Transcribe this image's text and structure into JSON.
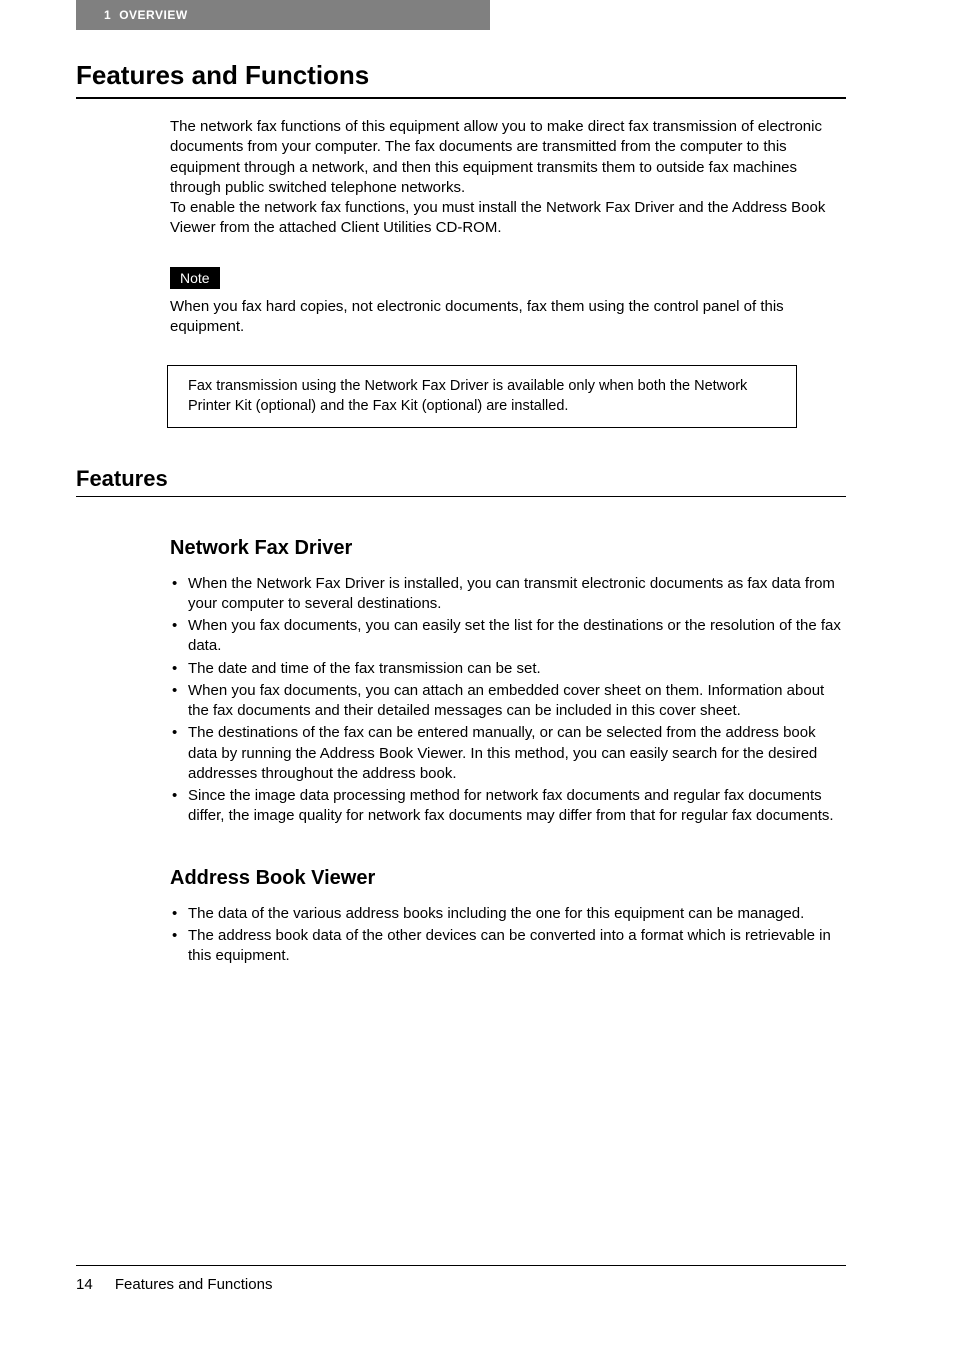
{
  "header": {
    "chapter_number": "1",
    "chapter_title": "OVERVIEW"
  },
  "main_heading": "Features and Functions",
  "intro_paragraph_1": "The network fax functions of this equipment allow you to make direct fax transmission of electronic documents from your computer. The fax documents are transmitted from the computer to this equipment through a network, and then this equipment transmits them to outside fax machines through public switched telephone networks.",
  "intro_paragraph_2": "To enable the network fax functions, you must install the Network Fax Driver and the Address Book Viewer from the attached Client Utilities CD-ROM.",
  "note": {
    "label": "Note",
    "text": "When you fax hard copies, not electronic documents, fax them using the control panel of this equipment."
  },
  "boxed_text": "Fax transmission using the Network Fax Driver is available only when both the Network Printer Kit (optional) and the Fax Kit (optional) are installed.",
  "features_heading": "Features",
  "subsections": [
    {
      "heading": "Network Fax Driver",
      "bullets": [
        "When the Network Fax Driver is installed, you can transmit electronic documents as fax data from your computer to several destinations.",
        "When you fax documents, you can easily set the list for the destinations or the resolution of the fax data.",
        "The date and time of the fax transmission can be set.",
        "When you fax documents, you can attach an embedded cover sheet on them. Information about the fax documents and their detailed messages can be included in this cover sheet.",
        "The destinations of the fax can be entered manually, or can be selected from the address book data by running the Address Book Viewer. In this method, you can easily search for the desired addresses throughout the address book.",
        "Since the image data processing method for network fax documents and regular fax documents differ, the image quality for network fax documents may differ from that for regular fax documents."
      ]
    },
    {
      "heading": "Address Book Viewer",
      "bullets": [
        "The data of the various address books including the one for this equipment can be managed.",
        "The address book data of the other devices can be converted into a format which is retrievable in this equipment."
      ]
    }
  ],
  "footer": {
    "page_number": "14",
    "section_title": "Features and Functions"
  }
}
